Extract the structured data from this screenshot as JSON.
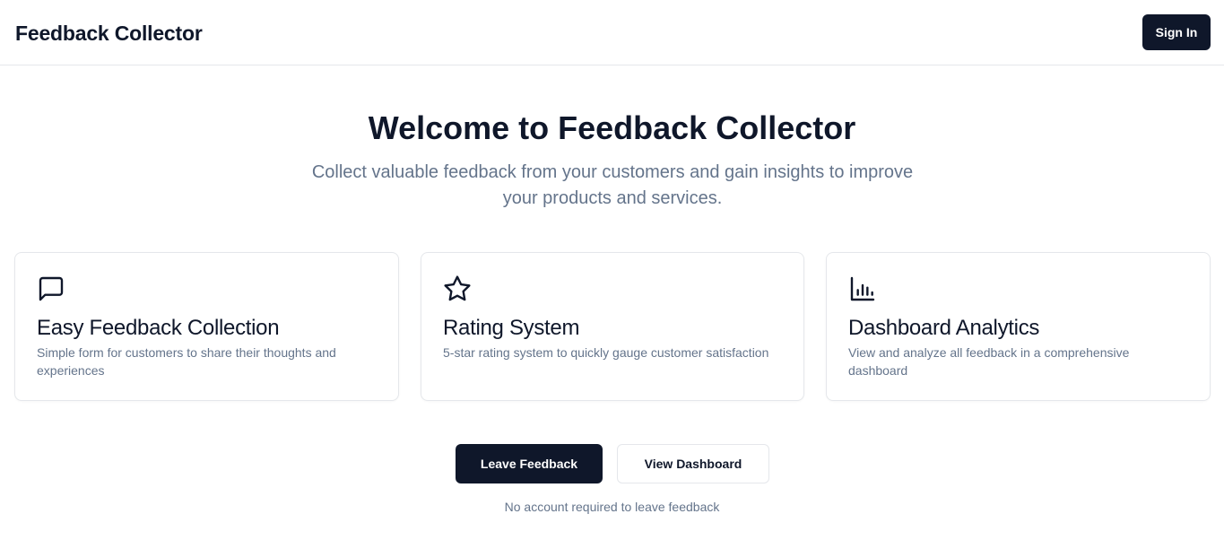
{
  "header": {
    "brand": "Feedback Collector",
    "signin_label": "Sign In"
  },
  "hero": {
    "title": "Welcome to Feedback Collector",
    "subtitle": "Collect valuable feedback from your customers and gain insights to improve your products and services."
  },
  "features": [
    {
      "icon": "message-square-icon",
      "title": "Easy Feedback Collection",
      "description": "Simple form for customers to share their thoughts and experiences"
    },
    {
      "icon": "star-icon",
      "title": "Rating System",
      "description": "5-star rating system to quickly gauge customer satisfaction"
    },
    {
      "icon": "bar-chart-icon",
      "title": "Dashboard Analytics",
      "description": "View and analyze all feedback in a comprehensive dashboard"
    }
  ],
  "actions": {
    "leave_label": "Leave Feedback",
    "view_label": "View Dashboard",
    "note": "No account required to leave feedback"
  },
  "colors": {
    "primary": "#0f172a",
    "muted_text": "#64748b",
    "border": "#e5e7eb",
    "background": "#ffffff"
  }
}
